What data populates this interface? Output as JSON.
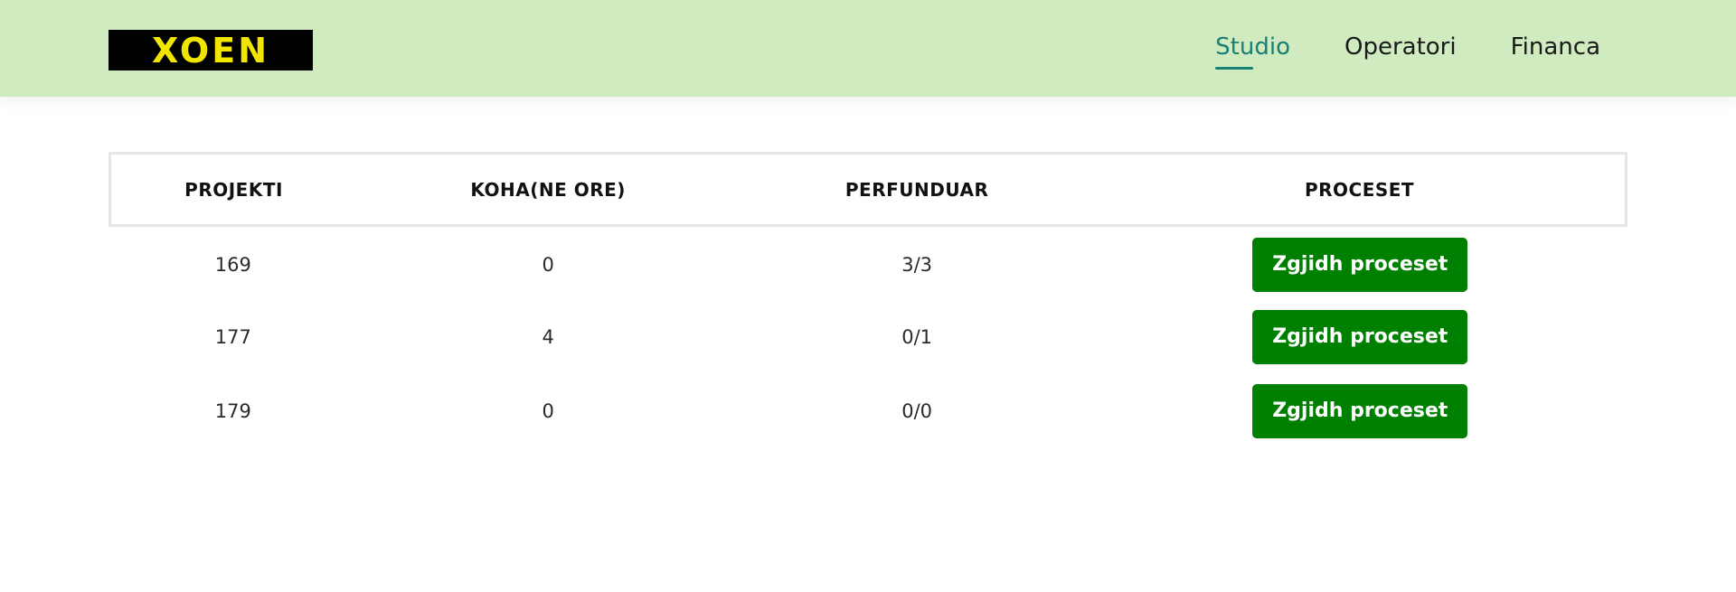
{
  "brand": {
    "logo_text": "XOEN"
  },
  "nav": {
    "items": [
      {
        "label": "Studio",
        "active": true
      },
      {
        "label": "Operatori",
        "active": false
      },
      {
        "label": "Financa",
        "active": false
      }
    ]
  },
  "table": {
    "headers": [
      "PROJEKTI",
      "KOHA(NE ORE)",
      "PERFUNDUAR",
      "PROCESET"
    ],
    "rows": [
      {
        "projekti": "169",
        "koha": "0",
        "perfunduar": "3/3",
        "action_label": "Zgjidh proceset"
      },
      {
        "projekti": "177",
        "koha": "4",
        "perfunduar": "0/1",
        "action_label": "Zgjidh proceset"
      },
      {
        "projekti": "179",
        "koha": "0",
        "perfunduar": "0/0",
        "action_label": "Zgjidh proceset"
      }
    ]
  },
  "colors": {
    "header_bg": "#d0ebc0",
    "accent": "#1b7f74",
    "button_bg": "#008000",
    "logo_bg": "#000000",
    "logo_text": "#f2e600"
  }
}
